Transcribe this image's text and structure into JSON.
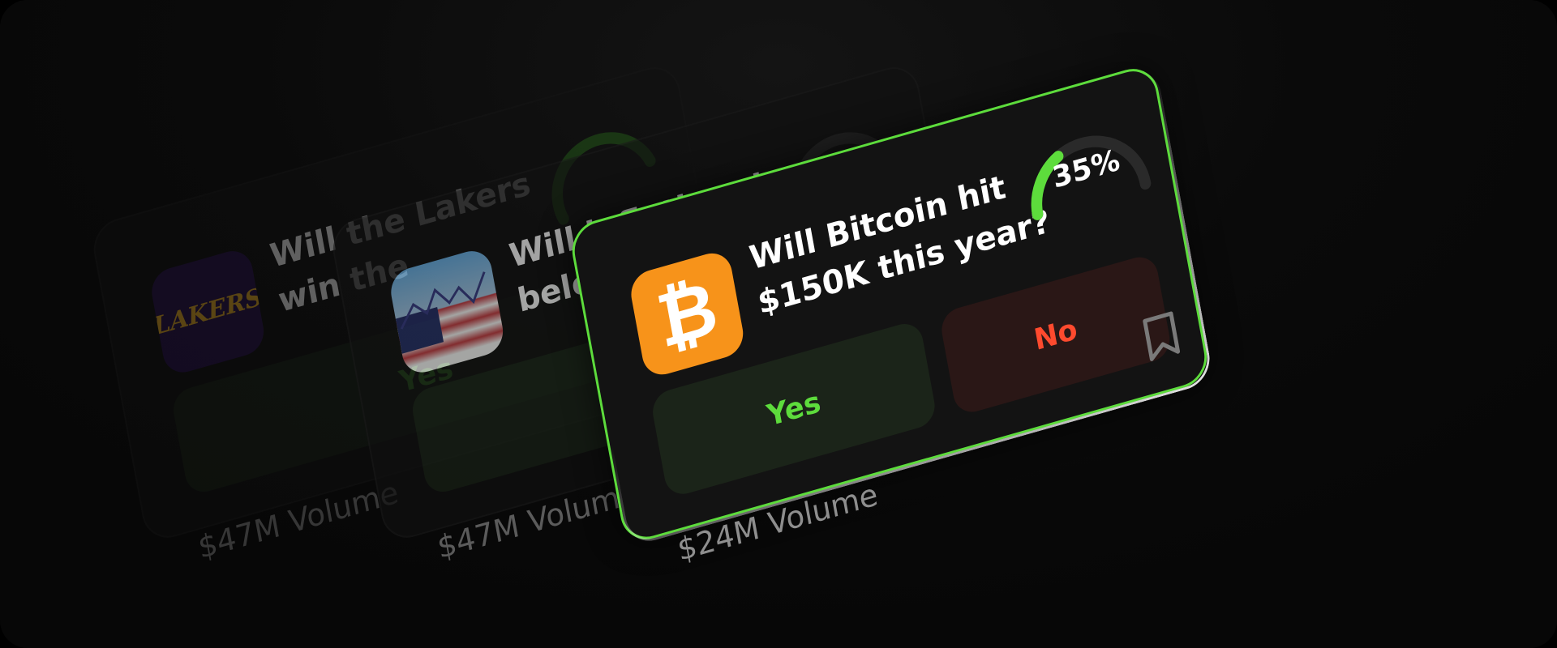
{
  "cards": [
    {
      "id": "lakers",
      "icon": "lakers-logo-icon",
      "logo_text": "LAKERS",
      "question": "Will the Lakers win the",
      "yes_label": "Yes",
      "volume": "$47M Volume"
    },
    {
      "id": "inflation",
      "icon": "us-flag-chart-icon",
      "question": "Will inflation drop below",
      "yes_label": "Yes",
      "volume": "$47M Volume"
    },
    {
      "id": "bitcoin",
      "icon": "bitcoin-icon",
      "logo_text": "₿",
      "question": "Will Bitcoin hit $150K this year?",
      "probability": 35,
      "probability_label": "35%",
      "yes_label": "Yes",
      "no_label": "No",
      "volume": "$24M Volume",
      "bookmark_icon": "bookmark-icon"
    }
  ],
  "colors": {
    "accent_green": "#5ddc3c",
    "no_red": "#ff4a2e",
    "bitcoin_orange": "#f7931a",
    "lakers_purple": "#2a1250",
    "lakers_gold": "#f0b428"
  }
}
